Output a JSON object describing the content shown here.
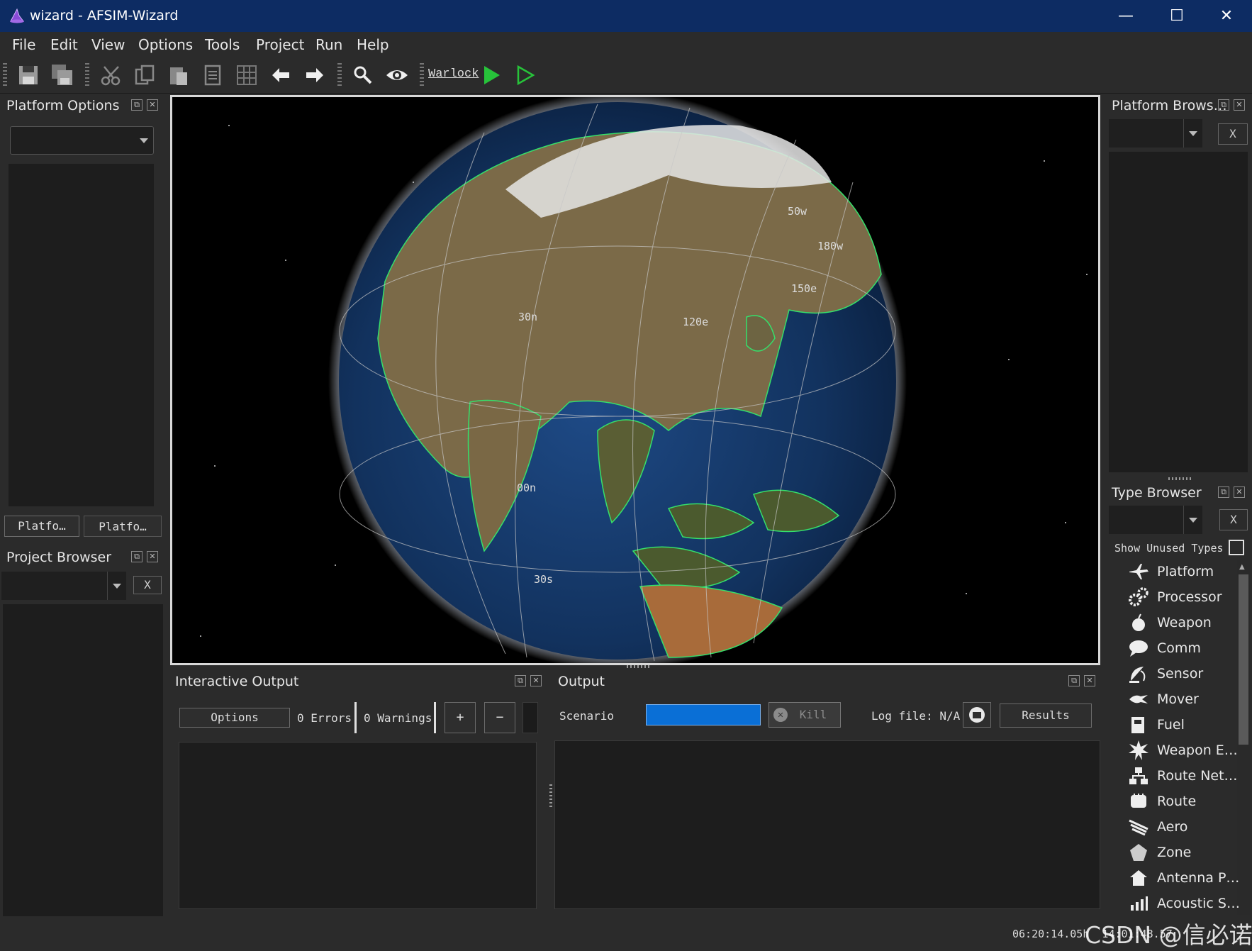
{
  "window": {
    "title": "wizard - AFSIM-Wizard",
    "minimize": "—",
    "maximize": "☐",
    "close": "✕"
  },
  "menu": [
    "File",
    "Edit",
    "View",
    "Options",
    "Tools",
    "Project",
    "Run",
    "Help"
  ],
  "toolbar": {
    "warlock_label": "Warlock",
    "icons": [
      "save-icon",
      "save-all-icon",
      "cut-icon",
      "copy-icon",
      "paste-icon",
      "print-icon",
      "grid-icon",
      "back-arrow-icon",
      "forward-arrow-icon",
      "search-icon",
      "eye-icon",
      "run-icon",
      "run-outline-icon"
    ]
  },
  "platform_options": {
    "title": "Platform Options",
    "tabs": [
      "Platfo…",
      "Platfo…"
    ]
  },
  "project_browser": {
    "title": "Project Browser",
    "clear": "X"
  },
  "platform_browser": {
    "title": "Platform Brows…",
    "clear": "X"
  },
  "type_browser": {
    "title": "Type Browser",
    "clear": "X",
    "show_unused_label": "Show Unused Types",
    "show_unused_checked": false,
    "items": [
      {
        "label": "Platform",
        "icon": "platform-icon"
      },
      {
        "label": "Processor",
        "icon": "processor-icon"
      },
      {
        "label": "Weapon",
        "icon": "weapon-icon"
      },
      {
        "label": "Comm",
        "icon": "comm-icon"
      },
      {
        "label": "Sensor",
        "icon": "sensor-icon"
      },
      {
        "label": "Mover",
        "icon": "mover-icon"
      },
      {
        "label": "Fuel",
        "icon": "fuel-icon"
      },
      {
        "label": "Weapon E…",
        "icon": "weapon-effect-icon"
      },
      {
        "label": "Route Net…",
        "icon": "route-network-icon"
      },
      {
        "label": "Route",
        "icon": "route-icon"
      },
      {
        "label": "Aero",
        "icon": "aero-icon"
      },
      {
        "label": "Zone",
        "icon": "zone-icon"
      },
      {
        "label": "Antenna P…",
        "icon": "antenna-icon"
      },
      {
        "label": "Acoustic S…",
        "icon": "acoustic-icon"
      }
    ]
  },
  "globe": {
    "labels": {
      "lon_150w": "50w",
      "lon_180w": "180w",
      "lon_150e": "150e",
      "lon_120e": "120e",
      "lat_00n": "00n",
      "lat_30s": "30s",
      "lat_30n": "30n"
    }
  },
  "interactive_output": {
    "title": "Interactive Output",
    "options_button": "Options",
    "errors": "0 Errors",
    "warnings": "0 Warnings",
    "plus": "+",
    "minus": "−"
  },
  "output": {
    "title": "Output",
    "scenario_label": "Scenario",
    "kill_label": "Kill",
    "log_file": "Log file: N/A",
    "results_button": "Results"
  },
  "status": {
    "time": "06:20:14.05h  14:01:48.57",
    "watermark": "CSDN @信必诺"
  },
  "colors": {
    "titlebar": "#0d2c63",
    "progress": "#0a6fd6",
    "run_green": "#27c33a"
  }
}
